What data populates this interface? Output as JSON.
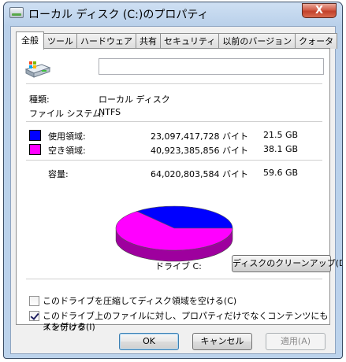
{
  "window": {
    "title": "ローカル ディスク (C:)のプロパティ",
    "close_label": "X"
  },
  "tabs": [
    {
      "label": "全般",
      "active": true
    },
    {
      "label": "ツール"
    },
    {
      "label": "ハードウェア"
    },
    {
      "label": "共有"
    },
    {
      "label": "セキュリティ"
    },
    {
      "label": "以前のバージョン"
    },
    {
      "label": "クォータ"
    }
  ],
  "general": {
    "name_value": "",
    "type_label": "種類:",
    "type_value": "ローカル ディスク",
    "fs_label": "ファイル システム:",
    "fs_value": "NTFS",
    "used": {
      "label": "使用領域:",
      "bytes": "23,097,417,728 バイト",
      "size": "21.5 GB",
      "color": "#0000ff"
    },
    "free": {
      "label": "空き領域:",
      "bytes": "40,923,385,856 バイト",
      "size": "38.1 GB",
      "color": "#ff00ff"
    },
    "capacity": {
      "label": "容量:",
      "bytes": "64,020,803,584 バイト",
      "size": "59.6 GB"
    },
    "drive_label": "ドライブ C:",
    "cleanup_button": "ディスクのクリーンアップ(D)"
  },
  "chart_data": {
    "type": "pie",
    "categories": [
      "使用領域",
      "空き領域"
    ],
    "values": [
      21.5,
      38.1
    ],
    "colors": [
      "#0000ff",
      "#ff00ff"
    ]
  },
  "options": {
    "compress": {
      "label": "このドライブを圧縮してディスク領域を空ける(C)",
      "checked": false
    },
    "index_line1": "このドライブ上のファイルに対し、プロパティだけでなくコンテンツにもインデック",
    "index_line2": "スを付ける(I)",
    "index_checked": true
  },
  "buttons": {
    "ok": "OK",
    "cancel": "キャンセル",
    "apply": "適用(A)"
  }
}
